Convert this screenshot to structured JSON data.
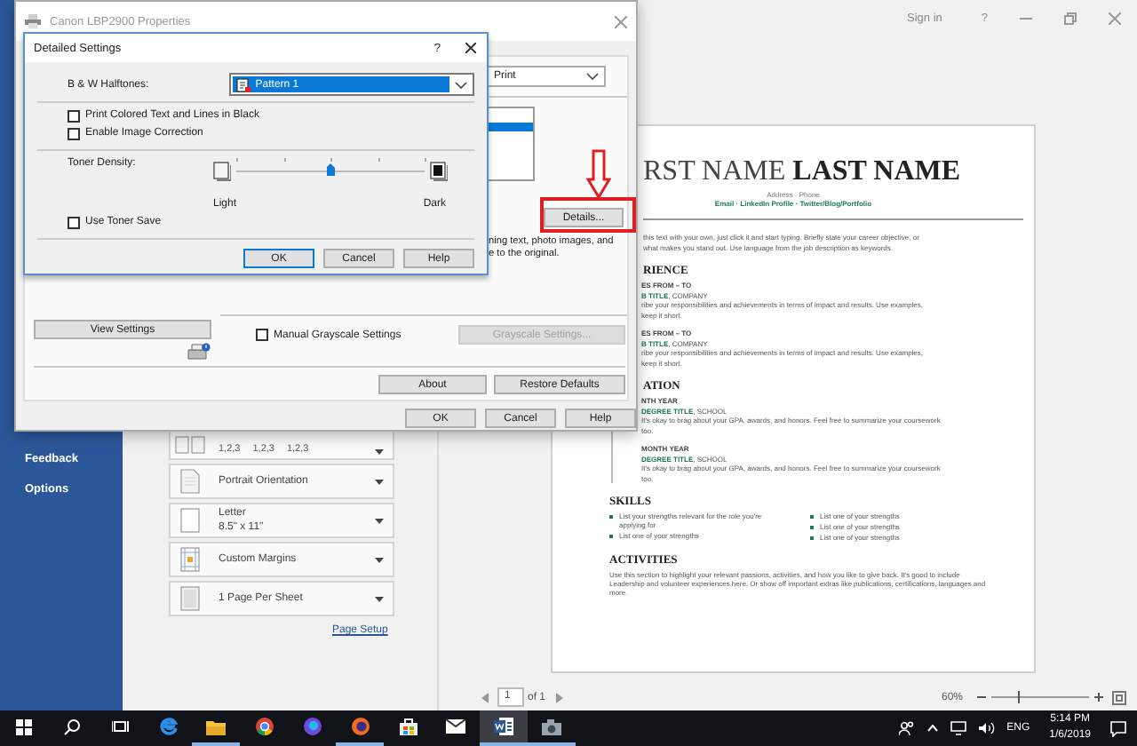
{
  "word": {
    "sidebar": {
      "items": [
        {
          "label": "Feedback"
        },
        {
          "label": "Options"
        }
      ]
    },
    "top_bar": {
      "sign_in": "Sign in",
      "help": "?"
    },
    "print_settings": [
      {
        "kind": "collate",
        "values": [
          "1,2,3",
          "1,2,3",
          "1,2,3"
        ]
      },
      {
        "kind": "orientation",
        "label": "Portrait Orientation"
      },
      {
        "kind": "paper",
        "label": "Letter",
        "subtitle": "8.5\" x 11\""
      },
      {
        "kind": "margins",
        "label": "Custom Margins"
      },
      {
        "kind": "sheet",
        "label": "1 Page Per Sheet"
      }
    ],
    "page_setup_link": "Page Setup",
    "resume": {
      "name": "RST NAME **LAST NAME**",
      "contact": "Address · Phone",
      "links": "Email · LinkedIn Profile · Twitter/Blog/Portfolio",
      "summary": [
        "this text with your own, just click it and start typing. Briefly state your career objective, or",
        "what makes you stand out. Use language from the job description as keywords."
      ],
      "sections": [
        {
          "kind": "timeline",
          "heading": "RIENCE",
          "entries": [
            {
              "date": "ES FROM – TO",
              "title": "**B TITLE**, COMPANY",
              "lines": [
                "ribe your responsibilities and achievements in terms of impact and results. Use examples,",
                "keep it short."
              ]
            },
            {
              "date": "ES FROM – TO",
              "title": "**B TITLE**, COMPANY",
              "lines": [
                "ribe your responsibilities and achievements in terms of impact and results. Use examples,",
                "keep it short."
              ]
            }
          ]
        },
        {
          "kind": "timeline",
          "heading": "ATION",
          "entries": [
            {
              "date": "NTH YEAR",
              "title": "**DEGREE TITLE**, SCHOOL",
              "lines": [
                "It's okay to brag about your GPA, awards, and honors. Feel free to summarize your coursework",
                "too."
              ]
            },
            {
              "date": "MONTH YEAR",
              "title": "**DEGREE TITLE**, SCHOOL",
              "lines": [
                "It's okay to brag about your GPA, awards, and honors. Feel free to summarize your coursework",
                "too."
              ]
            }
          ]
        },
        {
          "kind": "bullets",
          "heading": "SKILLS",
          "columns": [
            [
              "List your strengths relevant for the role you're applying for",
              "List one of your strengths"
            ],
            [
              "List one of your strengths",
              "List one of your strengths",
              "List one of your strengths"
            ]
          ]
        },
        {
          "kind": "paragraph",
          "heading": "ACTIVITIES",
          "text": "Use this section to highlight your relevant passions, activities, and how you like to give back. It's good to include Leadership and volunteer experiences here. Or show off important extras like publications, certifications, languages and more."
        }
      ]
    },
    "page_nav": {
      "page": "1",
      "total": "of 1"
    },
    "zoom": {
      "label": "60%",
      "level": 0.27
    }
  },
  "properties_window": {
    "title": "Canon LBP2900 Properties",
    "output_combo": "Print",
    "details_button": "Details...",
    "description": [
      "ning text, photo images, and",
      "e to the original."
    ],
    "view_settings": "View Settings",
    "manual_grayscale": {
      "label": "Manual Grayscale Settings",
      "checked": false
    },
    "grayscale_button": {
      "label": "Grayscale Settings...",
      "disabled": true
    },
    "panel_buttons": [
      "About",
      "Restore Defaults"
    ],
    "buttons": [
      "OK",
      "Cancel",
      "Help"
    ]
  },
  "detailed_settings": {
    "title": "Detailed Settings",
    "help": "?",
    "halftones_label": "B & W Halftones:",
    "halftones_value": "Pattern 1",
    "options": [
      {
        "label": "Print Colored Text and Lines in Black",
        "checked": false
      },
      {
        "label": "Enable Image Correction",
        "checked": false
      }
    ],
    "toner_density": {
      "label": "Toner Density:",
      "level": 0.5,
      "min_label": "Light",
      "max_label": "Dark"
    },
    "toner_save": {
      "label": "Use Toner Save",
      "checked": false
    },
    "buttons": [
      "OK",
      "Cancel",
      "Help"
    ]
  },
  "taskbar": {
    "apps": [
      {
        "running": false,
        "selected": false
      },
      {
        "running": false,
        "selected": false
      },
      {
        "running": false,
        "selected": false
      },
      {
        "running": false,
        "selected": false
      },
      {
        "running": true,
        "selected": false
      },
      {
        "running": false,
        "selected": false
      },
      {
        "running": false,
        "selected": false
      },
      {
        "running": true,
        "selected": false
      },
      {
        "running": false,
        "selected": false
      },
      {
        "running": false,
        "selected": false
      },
      {
        "running": true,
        "selected": true
      },
      {
        "running": true,
        "selected": false
      }
    ],
    "language": "ENG",
    "time": "5:14 PM",
    "date": "1/6/2019"
  }
}
